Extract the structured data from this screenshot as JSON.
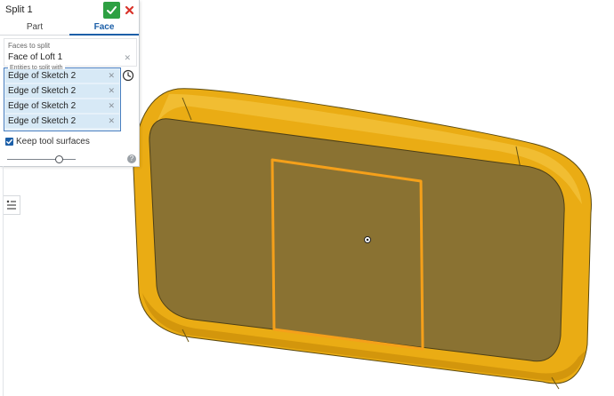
{
  "dialog": {
    "title": "Split 1",
    "ok_icon": "check-icon",
    "cancel_icon": "close-icon",
    "tabs": [
      {
        "label": "Part",
        "active": false
      },
      {
        "label": "Face",
        "active": true
      }
    ],
    "faces_to_split": {
      "label": "Faces to split",
      "value": "Face of Loft 1"
    },
    "entities_to_split_with": {
      "label": "Entities to split with",
      "items": [
        "Edge of Sketch 2",
        "Edge of Sketch 2",
        "Edge of Sketch 2",
        "Edge of Sketch 2"
      ]
    },
    "keep_tool_surfaces": {
      "label": "Keep tool surfaces",
      "checked": true
    },
    "slider_level": 0.75
  },
  "colors": {
    "accent_blue": "#1c5fa8",
    "ok_green": "#2ea043",
    "cancel_red": "#d9342b",
    "part_gold": "#eaac14",
    "face_olive": "#8a7232",
    "sketch_orange": "#f5a01a"
  }
}
